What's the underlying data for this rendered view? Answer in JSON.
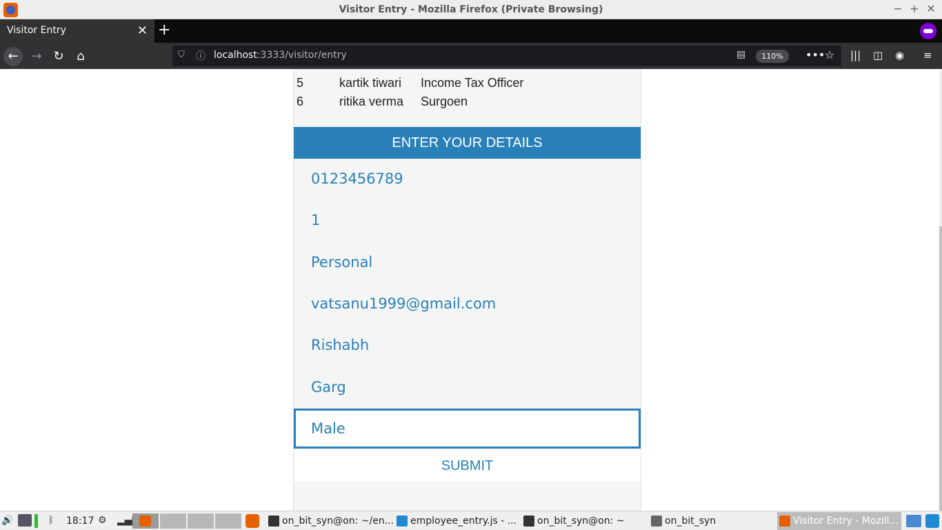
{
  "window": {
    "title": "Visitor Entry - Mozilla Firefox (Private Browsing)",
    "minimize": "−",
    "maximize": "+",
    "close": "✕"
  },
  "tabs": [
    {
      "label": "Visitor Entry",
      "close": "✕"
    }
  ],
  "new_tab": "+",
  "nav": {
    "back": "←",
    "forward": "→",
    "reload": "↻",
    "home": "⌂",
    "url_host": "localhost",
    "url_rest": ":3333/visitor/entry",
    "zoom": "110%",
    "more": "•••",
    "star": "☆"
  },
  "employees": [
    {
      "id": "5",
      "name": "kartik tiwari",
      "designation": "Income Tax Officer"
    },
    {
      "id": "6",
      "name": "ritika verma",
      "designation": "Surgoen"
    }
  ],
  "form": {
    "header": "ENTER YOUR DETAILS",
    "fields": [
      {
        "value": "0123456789"
      },
      {
        "value": "1"
      },
      {
        "value": "Personal"
      },
      {
        "value": "vatsanu1999@gmail.com"
      },
      {
        "value": "Rishabh"
      },
      {
        "value": "Garg"
      },
      {
        "value": "Male"
      }
    ],
    "submit": "SUBMIT"
  },
  "taskbar": {
    "clock": "18:17",
    "tasks": [
      {
        "label": "on_bit_syn@on: ~/en...",
        "icon": "terminal-icon"
      },
      {
        "label": "employee_entry.js - ...",
        "icon": "vscode-icon"
      },
      {
        "label": "on_bit_syn@on: ~",
        "icon": "terminal-icon"
      },
      {
        "label": "on_bit_syn",
        "icon": "folder-icon"
      },
      {
        "label": "Visitor Entry - Mozill...",
        "icon": "firefox-icon"
      }
    ]
  },
  "colors": {
    "accent": "#2980b9",
    "panel_bg": "#f5f5f5"
  }
}
